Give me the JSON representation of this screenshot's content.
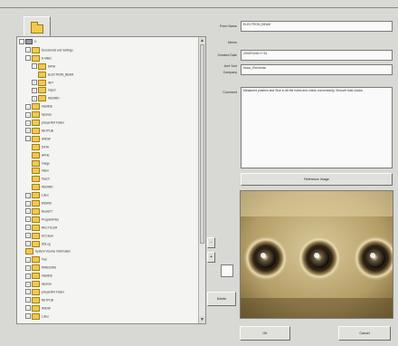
{
  "form": {
    "name_label": "Form Name",
    "name_value": "ELECTRON_BEAM",
    "memo_label": "Memo",
    "created_label": "Created Date",
    "created_value": "2002/01/08 17:51",
    "author_label": "And Yoni",
    "company_label": "Company",
    "company_value": "Ishou_Electronic",
    "comment_label": "Comment",
    "comment_value": "Measured position and Size in all the holes and check concentricity. Smooth hold clocks.",
    "reference_button": "Reference Image",
    "delete_button": "Delete",
    "ok_button": "OK",
    "cancel_button": "Cancel"
  },
  "tree": {
    "items": [
      {
        "label": "C:",
        "depth": 0,
        "kind": "drive",
        "exp": "-"
      },
      {
        "label": "Documents and Settings",
        "depth": 1,
        "kind": "folder",
        "exp": "+"
      },
      {
        "label": "E-Mlain",
        "depth": 1,
        "kind": "folder",
        "exp": "-"
      },
      {
        "label": "DATA",
        "depth": 2,
        "kind": "folder",
        "exp": "-"
      },
      {
        "label": "ELECTRON_BEAM",
        "depth": 3,
        "kind": "folder",
        "exp": ""
      },
      {
        "label": "INIT",
        "depth": 2,
        "kind": "folder",
        "exp": "+"
      },
      {
        "label": "Inspct",
        "depth": 2,
        "kind": "folder",
        "exp": "+"
      },
      {
        "label": "WIZARD",
        "depth": 2,
        "kind": "folder",
        "exp": "+"
      },
      {
        "label": "IntelliDE",
        "depth": 1,
        "kind": "folder",
        "exp": "+"
      },
      {
        "label": "Ispance",
        "depth": 1,
        "kind": "folder",
        "exp": "+"
      },
      {
        "label": "phoyer004 Folder",
        "depth": 1,
        "kind": "folder",
        "exp": "+"
      },
      {
        "label": "NETPUB",
        "depth": 1,
        "kind": "folder",
        "exp": "+"
      },
      {
        "label": "ANDW",
        "depth": 1,
        "kind": "folder",
        "exp": "-"
      },
      {
        "label": "DATA",
        "depth": 2,
        "kind": "folder",
        "exp": ""
      },
      {
        "label": "APHE",
        "depth": 2,
        "kind": "folder",
        "exp": ""
      },
      {
        "label": "Image",
        "depth": 2,
        "kind": "folder",
        "exp": ""
      },
      {
        "label": "Intern",
        "depth": 2,
        "kind": "folder",
        "exp": ""
      },
      {
        "label": "Teach",
        "depth": 2,
        "kind": "folder",
        "exp": ""
      },
      {
        "label": "WIZARD",
        "depth": 2,
        "kind": "folder",
        "exp": ""
      },
      {
        "label": "Lotus",
        "depth": 1,
        "kind": "folder",
        "exp": "+"
      },
      {
        "label": "MSWIO",
        "depth": 1,
        "kind": "folder",
        "exp": "+"
      },
      {
        "label": "NewaXT",
        "depth": 1,
        "kind": "folder",
        "exp": "+"
      },
      {
        "label": "ProgramFiles",
        "depth": 1,
        "kind": "folder",
        "exp": "+"
      },
      {
        "label": "RECYCLER",
        "depth": 1,
        "kind": "folder",
        "exp": "+"
      },
      {
        "label": "SCClearr",
        "depth": 1,
        "kind": "folder",
        "exp": "+"
      },
      {
        "label": "SDLog",
        "depth": 1,
        "kind": "folder",
        "exp": "+"
      },
      {
        "label": "System Volume Information",
        "depth": 1,
        "kind": "folder",
        "exp": ""
      },
      {
        "label": "Tool",
        "depth": 1,
        "kind": "folder",
        "exp": "+"
      },
      {
        "label": "WINDOWS",
        "depth": 1,
        "kind": "folder",
        "exp": "+"
      },
      {
        "label": "IntelliDE",
        "depth": 1,
        "kind": "folder",
        "exp": "+"
      },
      {
        "label": "Ispance",
        "depth": 1,
        "kind": "folder",
        "exp": "+"
      },
      {
        "label": "phoyer004 Folder",
        "depth": 1,
        "kind": "folder",
        "exp": "+"
      },
      {
        "label": "NETPUB",
        "depth": 1,
        "kind": "folder",
        "exp": "+"
      },
      {
        "label": "ANDW",
        "depth": 1,
        "kind": "folder",
        "exp": "+"
      },
      {
        "label": "Lotus",
        "depth": 1,
        "kind": "folder",
        "exp": "+"
      }
    ]
  },
  "icons": {
    "open_folder": "folder-open-icon",
    "scroll_up": "▲",
    "scroll_down": "▼",
    "minus": "-",
    "plus": "+"
  }
}
